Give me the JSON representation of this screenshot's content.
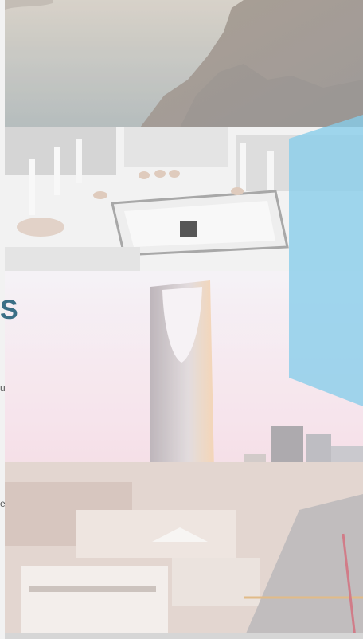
{
  "image": {
    "panels": [
      {
        "subject": "rocky-cliff-over-sea"
      },
      {
        "subject": "grand-mosque-courtyard"
      },
      {
        "subject": "city-skyline-with-tower"
      }
    ],
    "overlay_color": "#86cdea"
  },
  "fragments": {
    "left_glyph": "S",
    "left_text_1": "u",
    "left_text_2": "e"
  }
}
